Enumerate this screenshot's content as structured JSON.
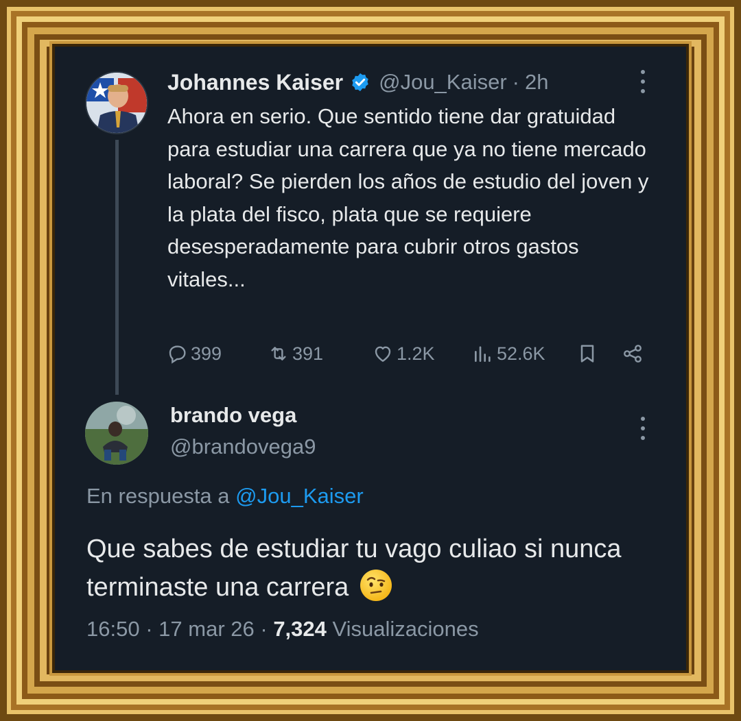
{
  "main_tweet": {
    "author_name": "Johannes Kaiser",
    "handle": "@Jou_Kaiser",
    "separator": "·",
    "time": "2h",
    "text": "Ahora en serio. Que sentido tiene dar gratuidad para estudiar una carrera que ya no tiene mercado laboral? Se pierden los años de estudio del joven y la plata del fisco, plata que se requiere desesperadamente para cubrir otros gastos vitales...",
    "stats": {
      "replies": "399",
      "reposts": "391",
      "likes": "1.2K",
      "views": "52.6K"
    }
  },
  "reply_tweet": {
    "author_name": "brando vega",
    "handle": "@brandovega9",
    "in_reply_prefix": "En respuesta a",
    "in_reply_handle": "@Jou_Kaiser",
    "text": "Que sabes de estudiar tu vago culiao si nunca terminaste una carrera",
    "emoji": "face-with-raised-eyebrow",
    "time": "16:50",
    "separator": "·",
    "date": "17 mar 26",
    "views_count": "7,324",
    "views_label": "Visualizaciones"
  },
  "colors": {
    "background": "#151d27",
    "text": "#e7e9ea",
    "secondary": "#8b98a5",
    "link": "#1d9bf0",
    "verified": "#1d9bf0",
    "frame_gold": "#c9983e"
  }
}
